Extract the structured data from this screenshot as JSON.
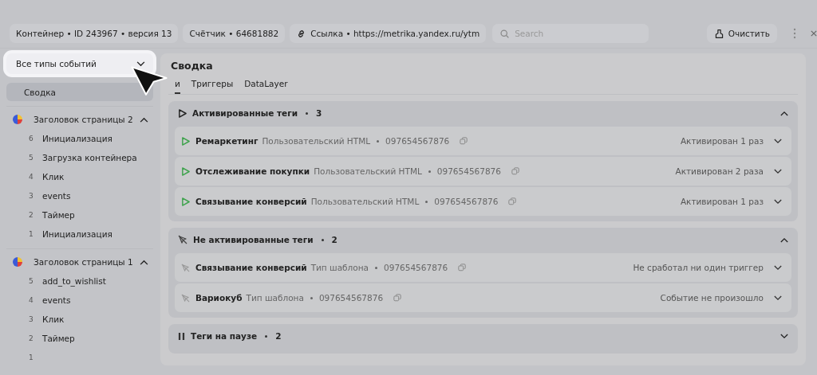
{
  "toolbar": {
    "chips": [
      {
        "label": "Контейнер • ID 243967 • версия 13",
        "icon": false
      },
      {
        "label": "Счётчик • 64681882",
        "icon": false
      },
      {
        "label": "Ссылка • https://metrika.yandex.ru/ytm",
        "icon": true
      }
    ],
    "search": {
      "placeholder": "Search"
    },
    "clear_button": "Очистить"
  },
  "sidebar": {
    "filter": {
      "value": "Все типы событий"
    },
    "items": [
      {
        "label": "Сводка",
        "selected": true
      }
    ],
    "groups": [
      {
        "title": "Заголовок страницы 2",
        "expanded": true,
        "events": [
          {
            "num": "6",
            "label": "Инициализация"
          },
          {
            "num": "5",
            "label": "Загрузка контейнера"
          },
          {
            "num": "4",
            "label": "Клик"
          },
          {
            "num": "3",
            "label": "events"
          },
          {
            "num": "2",
            "label": "Таймер"
          },
          {
            "num": "1",
            "label": "Инициализация"
          }
        ]
      },
      {
        "title": "Заголовок страницы 1",
        "expanded": true,
        "events": [
          {
            "num": "5",
            "label": "add_to_wishlist"
          },
          {
            "num": "4",
            "label": "events"
          },
          {
            "num": "3",
            "label": "Клик"
          },
          {
            "num": "2",
            "label": "Таймер"
          },
          {
            "num": "1"
          }
        ]
      }
    ]
  },
  "main": {
    "title": "Сводка",
    "tabs": [
      {
        "label": "и",
        "selected": true
      },
      {
        "label": "Триггеры",
        "selected": false
      },
      {
        "label": "DataLayer",
        "selected": false
      }
    ],
    "sections": [
      {
        "kind": "active",
        "title": "Активированные теги",
        "count": "3",
        "expanded": true,
        "tags": [
          {
            "name": "Ремаркетинг",
            "type": "Пользовательский HTML",
            "id": "097654567876",
            "status": "Активирован 1 раз"
          },
          {
            "name": "Отслеживание покупки",
            "type": "Пользовательский HTML",
            "id": "097654567876",
            "status": "Активирован 2 раза"
          },
          {
            "name": "Связывание конверсий",
            "type": "Пользовательский HTML",
            "id": "097654567876",
            "status": "Активирован 1 раз"
          }
        ]
      },
      {
        "kind": "inactive",
        "title": "Не активированные теги",
        "count": "2",
        "expanded": true,
        "tags": [
          {
            "name": "Связывание конверсий",
            "type": "Тип шаблона",
            "id": "097654567876",
            "status": "Не сработал ни один триггер"
          },
          {
            "name": "Вариокуб",
            "type": "Тип шаблона",
            "id": "097654567876",
            "status": "Событие не произошло"
          }
        ]
      },
      {
        "kind": "paused",
        "title": "Теги на паузе",
        "count": "2",
        "expanded": false
      }
    ]
  }
}
